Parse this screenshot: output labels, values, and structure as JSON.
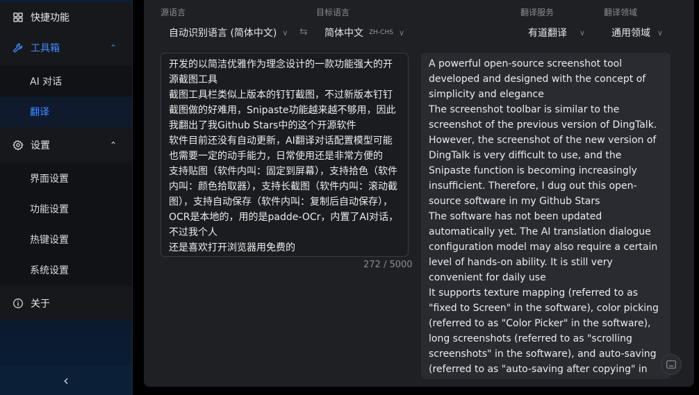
{
  "sidebar": {
    "quick_features": "快捷功能",
    "toolbox": "工具箱",
    "toolbox_items": [
      "AI 对话",
      "翻译"
    ],
    "settings": "设置",
    "settings_items": [
      "界面设置",
      "功能设置",
      "热键设置",
      "系统设置"
    ],
    "about": "关于",
    "collapse_glyph": "‹",
    "toolbox_chevron": "⌃",
    "settings_chevron": "⌃"
  },
  "translate": {
    "source_lang_label": "源语言",
    "source_lang_value": "自动识别语言 (简体中文)",
    "target_lang_label": "目标语言",
    "target_lang_value": "简体中文",
    "target_lang_code": "ZH-CHS",
    "service_label": "翻译服务",
    "service_value": "有道翻译",
    "domain_label": "翻译领域",
    "domain_value": "通用领域",
    "swap_glyph": "⇆",
    "dropdown_glyph": "∨",
    "source_text": "开发的以简洁优雅作为理念设计的一款功能强大的开源截图工具\n截图工具栏类似上版本的钉钉截图，不过新版本钉钉截图做的好难用，Snipaste功能越来越不够用，因此我翻出了我Github Stars中的这个开源软件\n软件目前还没有自动更新，AI翻译对话配置模型可能也需要一定的动手能力，日常使用还是非常方便的\n支持贴图（软件内叫：固定到屏幕），支持拾色（软件内叫：颜色拾取器），支持长截图（软件内叫：滚动截图），支持自动保存（软件内叫：复制后自动保存），OCR是本地的，用的是padde-OCr，内置了AI对话，不过我个人\n还是喜欢打开浏览器用免费的",
    "char_count": "272 / 5000",
    "output_text": "A powerful open-source screenshot tool developed and designed with the concept of simplicity and elegance\nThe screenshot toolbar is similar to the screenshot of the previous version of DingTalk. However, the screenshot of the new version of DingTalk is very difficult to use, and the Snipaste function is becoming increasingly insufficient. Therefore, I dug out this open-source software in my Github Stars\nThe software has not been updated automatically yet. The AI translation dialogue configuration model may also require a certain level of hands-on ability. It is still very convenient for daily use\nIt supports texture mapping (referred to as \"fixed to Screen\" in the software), color picking (referred to as \"Color Picker\" in the software), long screenshots (referred to as \"scrolling screenshots\" in the software), and auto-saving (referred to as \"auto-saving after copying\" in the software). The OCR is local, using padde-OCr, and it has built-in AI dialogue, but it's my personal experience"
  },
  "colors": {
    "accent": "#3f8cff",
    "sidebar_bg": "#16171b",
    "panel_bg": "#1f2024"
  }
}
